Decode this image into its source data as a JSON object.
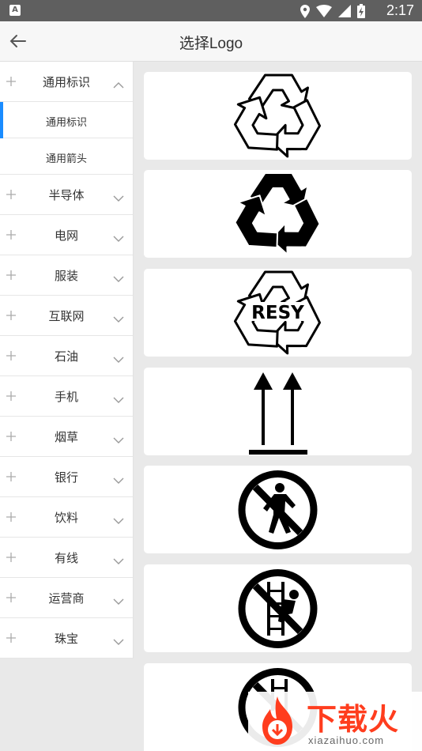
{
  "status_bar": {
    "app_icon_letter": "A",
    "time": "2:17",
    "icons": [
      "location-icon",
      "wifi-icon",
      "signal-icon",
      "battery-charging-icon"
    ]
  },
  "app_bar": {
    "title": "选择Logo",
    "back_icon": "arrow-left-icon"
  },
  "sidebar": {
    "categories": [
      {
        "label": "通用标识",
        "expanded": true,
        "subitems": [
          {
            "label": "通用标识",
            "selected": true
          },
          {
            "label": "通用箭头",
            "selected": false
          }
        ]
      },
      {
        "label": "半导体",
        "expanded": false
      },
      {
        "label": "电网",
        "expanded": false
      },
      {
        "label": "服装",
        "expanded": false
      },
      {
        "label": "互联网",
        "expanded": false
      },
      {
        "label": "石油",
        "expanded": false
      },
      {
        "label": "手机",
        "expanded": false
      },
      {
        "label": "烟草",
        "expanded": false
      },
      {
        "label": "银行",
        "expanded": false
      },
      {
        "label": "饮料",
        "expanded": false
      },
      {
        "label": "有线",
        "expanded": false
      },
      {
        "label": "运营商",
        "expanded": false
      },
      {
        "label": "珠宝",
        "expanded": false
      }
    ]
  },
  "logos": [
    {
      "icon": "recycle-outline-icon"
    },
    {
      "icon": "recycle-solid-icon"
    },
    {
      "icon": "recycle-resy-icon",
      "text": "RESY"
    },
    {
      "icon": "this-way-up-arrows-icon"
    },
    {
      "icon": "no-pedestrians-icon"
    },
    {
      "icon": "no-climbing-icon"
    },
    {
      "icon": "no-ladder-icon"
    }
  ],
  "watermark": {
    "brand": "下载火",
    "url": "xiazaihuo.com"
  },
  "colors": {
    "status_bar": "#5f5f5f",
    "accent": "#1a8cff",
    "watermark": "#ff3d1e"
  }
}
